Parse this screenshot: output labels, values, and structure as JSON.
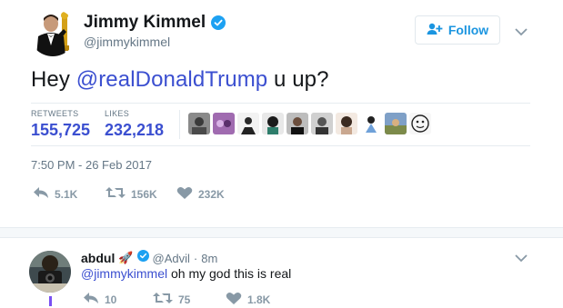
{
  "author": {
    "name": "Jimmy Kimmel",
    "handle": "@jimmykimmel",
    "verified_icon": "verified-badge-icon",
    "avatar_icon": "tuxedo-oscar-avatar"
  },
  "follow_button": {
    "label": "Follow",
    "icon": "add-person-icon"
  },
  "tweet": {
    "text_before": "Hey ",
    "mention": "@realDonaldTrump",
    "text_after": " u up?"
  },
  "stats": {
    "retweets_label": "RETWEETS",
    "retweets_value": "155,725",
    "likes_label": "LIKES",
    "likes_value": "232,218"
  },
  "timestamp": "7:50 PM - 26 Feb 2017",
  "actions": {
    "reply_count": "5.1K",
    "retweet_count": "156K",
    "like_count": "232K"
  },
  "reply": {
    "name": "abdul",
    "name_emoji": "🚀",
    "handle": "@Advil",
    "separator": "·",
    "time": "8m",
    "mention": "@jimmykimmel",
    "text": " oh my god this is real",
    "reply_count": "10",
    "retweet_count": "75",
    "like_count": "1.8K"
  },
  "colors": {
    "accent": "#1b95e0",
    "mention": "#3b4fd0",
    "muted": "#657786",
    "verified": "#1da1f2"
  }
}
